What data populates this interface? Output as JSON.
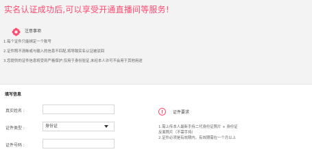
{
  "banner": {
    "title": "实名认证成功后,可以享受开通直播间等服务!"
  },
  "notice": {
    "title": "注意事项",
    "items": [
      "1.每个证件只能绑定一个账号",
      "2.证件照不清晰或与输入的信息不匹配,将导致实名认证被驳回",
      "3.您提供的证件信息将受到严格保护,仅用于身份验证,未经本人许可不会用于其他用途"
    ]
  },
  "form": {
    "section_title": "填写信息",
    "real_name_label": "真实姓名 :",
    "real_name_value": "",
    "id_type_label": "证件类型 :",
    "id_type_value": "身份证",
    "id_number_label": "证件号码 :",
    "id_number_value": ""
  },
  "requirements": {
    "title": "证件要求",
    "lines": [
      "1.需上传本人最新手持二代身份证照片 + 身份证",
      "反面照片（不需手持）",
      "2.证件必须是有效期内，有效期需在一个月以上"
    ]
  },
  "colors": {
    "accent": "#ff4a70",
    "panel_bg": "#f3f3f3"
  }
}
